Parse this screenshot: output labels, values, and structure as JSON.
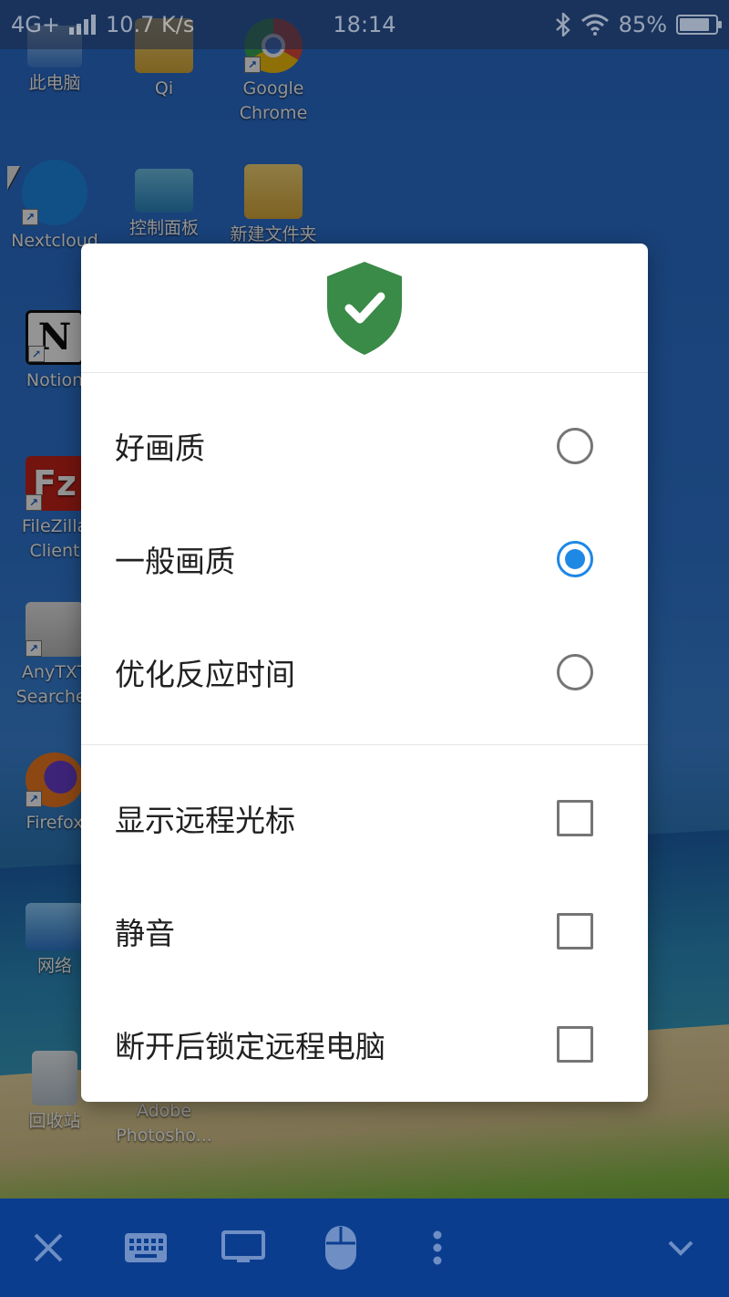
{
  "status_bar": {
    "network": "4G+",
    "speed": "10.7 K/s",
    "time": "18:14",
    "battery": "85%",
    "battery_level": 0.85
  },
  "desktop": {
    "icons": [
      {
        "label": "此电脑"
      },
      {
        "label": "Qi"
      },
      {
        "label": "Google Chrome"
      },
      {
        "label": "Nextcloud"
      },
      {
        "label": "控制面板"
      },
      {
        "label": "新建文件夹"
      },
      {
        "label": "Notion"
      },
      {
        "label": "FileZilla Client"
      },
      {
        "label": "AnyTXT Searcher"
      },
      {
        "label": "Firefox"
      },
      {
        "label": "网络"
      },
      {
        "label": "回收站"
      },
      {
        "label": "Adobe Photosho..."
      }
    ]
  },
  "dialog": {
    "header_icon": "shield-check-icon",
    "accent_color": "#1e88e5",
    "shield_color": "#3a8a48",
    "quality_options": [
      {
        "label": "好画质",
        "selected": false
      },
      {
        "label": "一般画质",
        "selected": true
      },
      {
        "label": "优化反应时间",
        "selected": false
      }
    ],
    "toggle_options": [
      {
        "label": "显示远程光标",
        "checked": false
      },
      {
        "label": "静音",
        "checked": false
      },
      {
        "label": "断开后锁定远程电脑",
        "checked": false
      }
    ]
  },
  "toolbar": {
    "buttons": [
      {
        "icon": "close-icon"
      },
      {
        "icon": "keyboard-icon"
      },
      {
        "icon": "monitor-icon"
      },
      {
        "icon": "mouse-icon"
      },
      {
        "icon": "more-vertical-icon"
      },
      {
        "icon": "chevron-down-icon"
      }
    ]
  }
}
